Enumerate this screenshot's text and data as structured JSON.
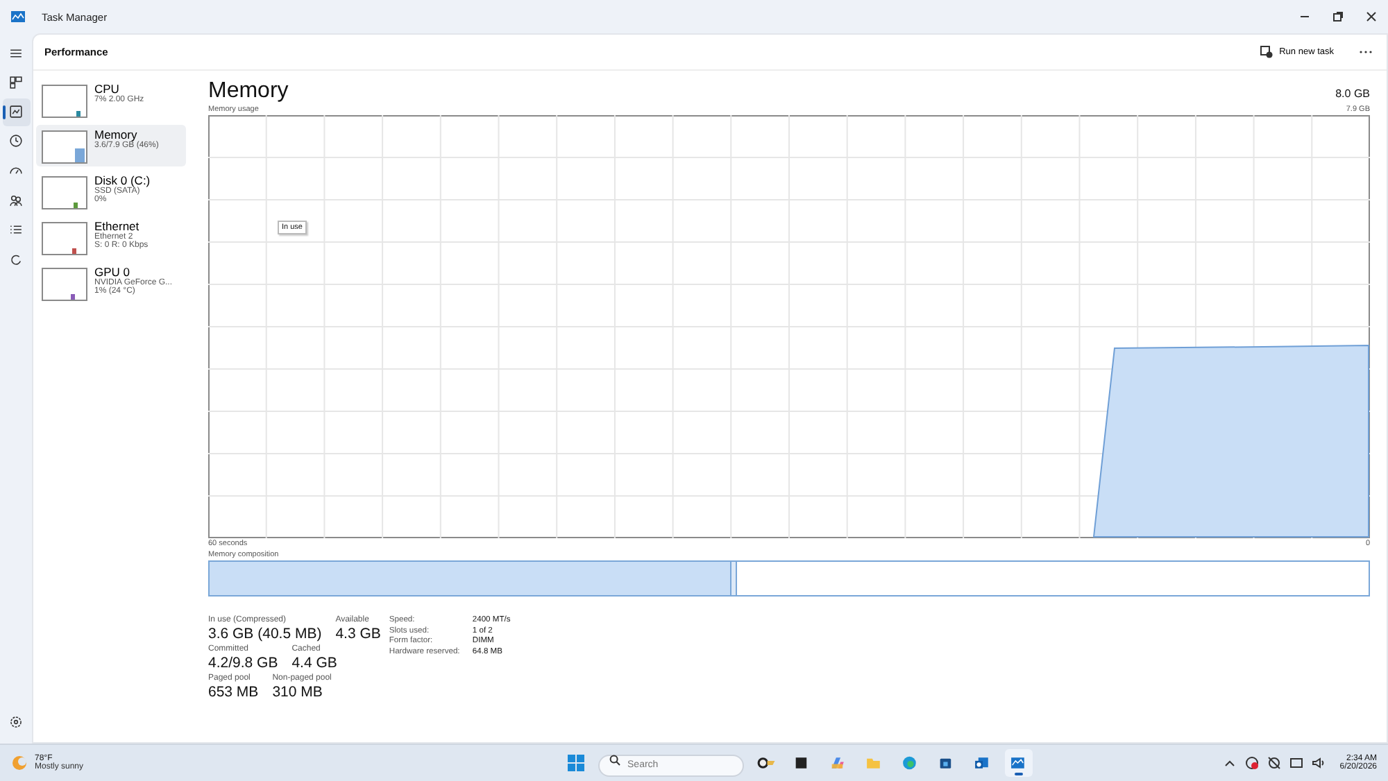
{
  "window": {
    "title": "Task Manager"
  },
  "nav": [
    {
      "kind": "menu",
      "selected": false
    },
    {
      "kind": "processes",
      "selected": false
    },
    {
      "kind": "performance",
      "selected": true
    },
    {
      "kind": "history",
      "selected": false
    },
    {
      "kind": "startup",
      "selected": false
    },
    {
      "kind": "users",
      "selected": false
    },
    {
      "kind": "details",
      "selected": false
    },
    {
      "kind": "services",
      "selected": false
    }
  ],
  "page_title": "Performance",
  "toolbar": {
    "run_new_task": "Run new task"
  },
  "devices": [
    {
      "name": "CPU",
      "details": [
        "7% 2.00 GHz"
      ],
      "selected": false,
      "color": "#2b8aa0"
    },
    {
      "name": "Memory",
      "details": [
        "3.6/7.9 GB (46%)"
      ],
      "selected": true,
      "color": "#7aa7d8"
    },
    {
      "name": "Disk 0 (C:)",
      "details": [
        "SSD (SATA)",
        "0%"
      ],
      "selected": false,
      "color": "#5c9a3c"
    },
    {
      "name": "Ethernet",
      "details": [
        "Ethernet 2",
        "S: 0 R: 0 Kbps"
      ],
      "selected": false,
      "color": "#c0504d"
    },
    {
      "name": "GPU 0",
      "details": [
        "NVIDIA GeForce G...",
        "1% (24 °C)"
      ],
      "selected": false,
      "color": "#8a5cb8"
    }
  ],
  "memory": {
    "title": "Memory",
    "total": "8.0 GB",
    "graph_label": "Memory usage",
    "graph_max": "7.9 GB",
    "time_span": "60 seconds",
    "graph_min": "0",
    "tooltip": "In use",
    "composition": {
      "label": "Memory composition",
      "level": 0.45
    }
  },
  "stat_rows": [
    {
      "items": [
        {
          "label": "In use (Compressed)",
          "value": "3.6 GB (40.5 MB)"
        },
        {
          "label": "Available",
          "value": "4.3 GB"
        }
      ]
    },
    {
      "items": [
        {
          "label": "Committed",
          "value": "4.2/9.8 GB"
        },
        {
          "label": "Cached",
          "value": "4.4 GB"
        }
      ]
    },
    {
      "items": [
        {
          "label": "Paged pool",
          "value": "653 MB"
        },
        {
          "label": "Non-paged pool",
          "value": "310 MB"
        }
      ]
    }
  ],
  "specs": [
    {
      "label": "Speed:",
      "value": "2400 MT/s"
    },
    {
      "label": "Slots used:",
      "value": "1 of 2"
    },
    {
      "label": "Form factor:",
      "value": "DIMM"
    },
    {
      "label": "Hardware reserved:",
      "value": "64.8 MB"
    }
  ],
  "taskbar": {
    "weather": {
      "temperature": "78°F",
      "condition": "Mostly sunny"
    },
    "search": {
      "placeholder": "Search"
    },
    "apps": [
      {
        "kind": "widget",
        "selected": false
      },
      {
        "kind": "terminal",
        "selected": false
      },
      {
        "kind": "copilot",
        "selected": false
      },
      {
        "kind": "folder",
        "selected": false
      },
      {
        "kind": "edge",
        "selected": false
      },
      {
        "kind": "store",
        "selected": false
      },
      {
        "kind": "outlook",
        "selected": false
      },
      {
        "kind": "taskmgr",
        "selected": true
      }
    ],
    "time": "2:34 AM",
    "date": "6/20/2026"
  }
}
